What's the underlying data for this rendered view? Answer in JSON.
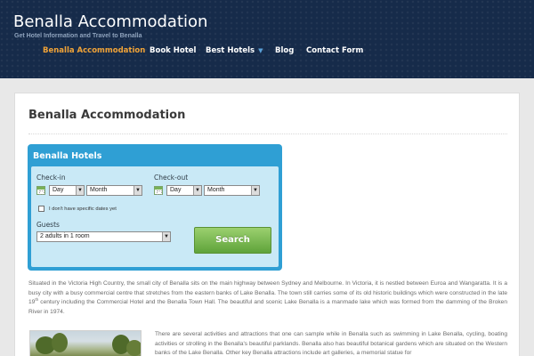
{
  "header": {
    "site_title": "Benalla Accommodation",
    "tagline": "Get Hotel Information and Travel to Benalla"
  },
  "nav": {
    "items": [
      {
        "label": "Benalla Accommodation",
        "active": true
      },
      {
        "label": "Book Hotel"
      },
      {
        "label": "Best Hotels",
        "has_dropdown": true
      },
      {
        "label": "Blog"
      },
      {
        "label": "Contact Form"
      }
    ]
  },
  "page": {
    "title": "Benalla Accommodation"
  },
  "widget": {
    "title": "Benalla Hotels",
    "checkin_label": "Check-in",
    "checkout_label": "Check-out",
    "day_value": "Day",
    "month_value": "Month",
    "no_dates_label": "I don't have specific dates yet",
    "guests_label": "Guests",
    "guests_value": "2 adults in 1 room",
    "search_label": "Search"
  },
  "content": {
    "para1_a": "Situated in the Victoria High Country, the small city of Benalla sits on the main highway between Sydney and Melbourne. In Victoria, it is nestled between Euroa and Wangaratta. It is a busy city with a busy commercial centre that stretches from the eastern banks of Lake Benalla. The town still carries some of its old historic buildings which were constructed in the late 19",
    "para1_sup": "th",
    "para1_b": " century including the Commercial Hotel and the Benalla Town Hall. The beautiful and scenic Lake Benalla is a manmade lake which was formed from the damming of the Broken River in 1974.",
    "para2": "There are several activities and attractions that one can sample while in Benalla such as swimming in Lake Benalla, cycling, boating activities or strolling in the Benalla's beautiful parklands. Benalla also has beautiful botanical gardens which are situated on the Western banks of the Lake Benalla. Other key Benalla attractions include art galleries, a memorial statue for"
  },
  "colors": {
    "header_bg": "#162b4a",
    "nav_active": "#f0a338",
    "widget_blue": "#2f9fd4",
    "widget_inner": "#c9e9f6",
    "search_green": "#6fb044"
  }
}
